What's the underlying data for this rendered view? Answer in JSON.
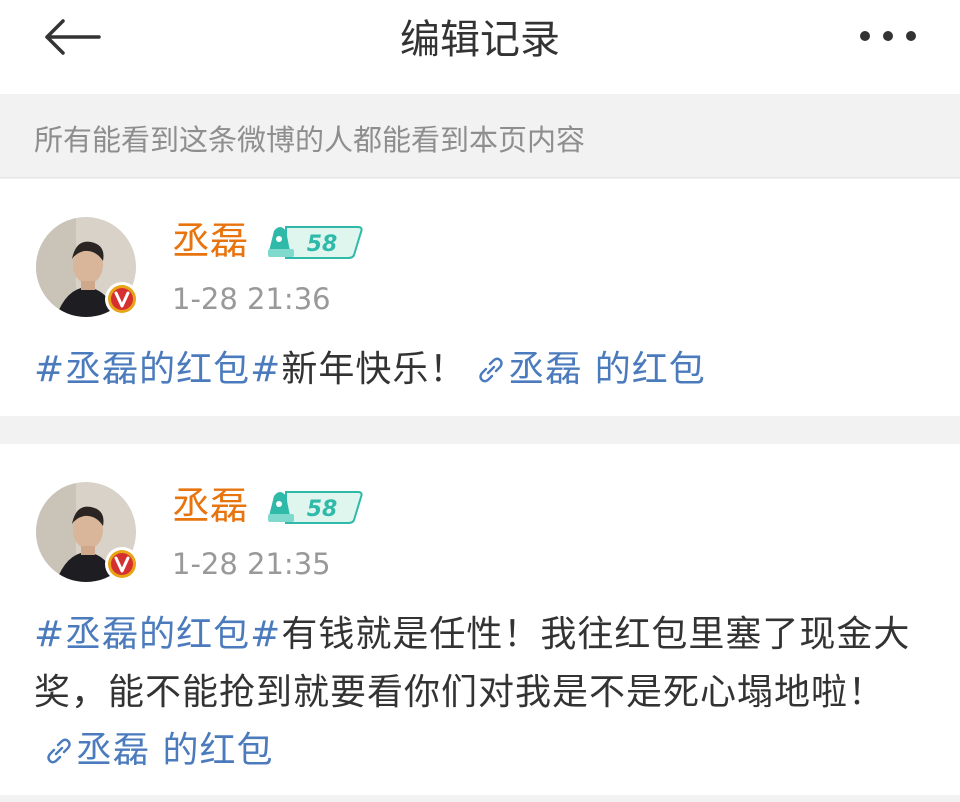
{
  "header": {
    "title": "编辑记录",
    "back_icon": "back-arrow-icon",
    "more_icon": "more-dots-icon"
  },
  "notice": "所有能看到这条微博的人都能看到本页内容",
  "colors": {
    "username": "#e8740f",
    "link": "#4b7bbd",
    "verified": "#e8a317",
    "level_badge": "#2fb9a9"
  },
  "posts": [
    {
      "username": "丞磊",
      "level": "58",
      "time": "1-28 21:36",
      "topic": "#丞磊的红包#",
      "text": "新年快乐！",
      "link_text": "丞磊 的红包"
    },
    {
      "username": "丞磊",
      "level": "58",
      "time": "1-28 21:35",
      "topic": "#丞磊的红包#",
      "text": "有钱就是任性！我往红包里塞了现金大奖，能不能抢到就要看你们对我是不是死心塌地啦！",
      "link_text": "丞磊 的红包"
    }
  ]
}
